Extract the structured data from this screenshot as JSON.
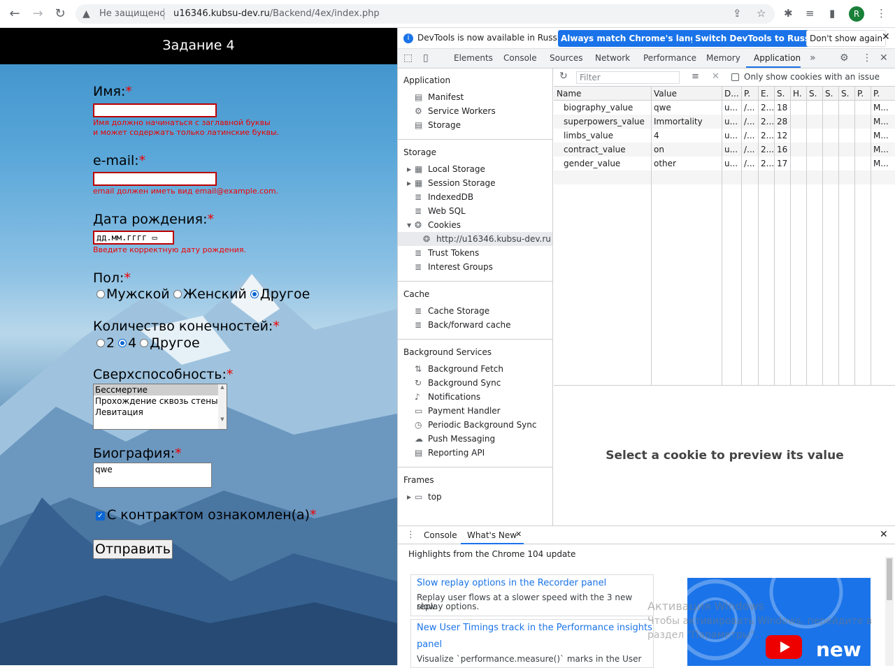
{
  "browser": {
    "security_label": "Не защищено",
    "url_host": "u16346.kubsu-dev.ru",
    "url_path": "/Backend/4ex/index.php",
    "profile_initial": "R"
  },
  "form": {
    "title": "Задание 4",
    "name_label": "Имя:",
    "name_error_line1": "Имя должно начинаться с заглавной буквы",
    "name_error_line2": "и может содержать только латинские буквы.",
    "email_label": "e-mail:",
    "email_error": "email должен иметь вид email@example.com.",
    "dob_label": "Дата рождения:",
    "dob_placeholder": "дд.мм.гггг",
    "dob_error": "Введите корректную дату рождения.",
    "gender_label": "Пол:",
    "gender_options": [
      "Мужской",
      "Женский",
      "Другое"
    ],
    "gender_selected": "Другое",
    "limbs_label": "Количество конечностей:",
    "limbs_options": [
      "2",
      "4",
      "Другое"
    ],
    "limbs_selected": "4",
    "power_label": "Сверхспособность:",
    "power_options": [
      "Бессмертие",
      "Прохождение сквозь стены",
      "Левитация"
    ],
    "power_selected": "Бессмертие",
    "bio_label": "Биография:",
    "bio_value": "qwe",
    "contract_label": "С контрактом ознакомлен(а)",
    "contract_checked": true,
    "required_mark": "*",
    "submit_label": "Отправить"
  },
  "devtools": {
    "infobar_text": "DevTools is now available in Russian!",
    "btn_match": "Always match Chrome's language",
    "btn_switch": "Switch DevTools to Russian",
    "btn_dont_show": "Don't show again",
    "tabs": [
      "Elements",
      "Console",
      "Sources",
      "Network",
      "Performance",
      "Memory",
      "Application"
    ],
    "active_tab": "Application",
    "sidebar": {
      "application_title": "Application",
      "application_items": [
        "Manifest",
        "Service Workers",
        "Storage"
      ],
      "storage_title": "Storage",
      "storage_items": [
        "Local Storage",
        "Session Storage",
        "IndexedDB",
        "Web SQL",
        "Cookies",
        "http://u16346.kubsu-dev.ru",
        "Trust Tokens",
        "Interest Groups"
      ],
      "cache_title": "Cache",
      "cache_items": [
        "Cache Storage",
        "Back/forward cache"
      ],
      "bg_title": "Background Services",
      "bg_items": [
        "Background Fetch",
        "Background Sync",
        "Notifications",
        "Payment Handler",
        "Periodic Background Sync",
        "Push Messaging",
        "Reporting API"
      ],
      "frames_title": "Frames",
      "frames_items": [
        "top"
      ]
    },
    "filter_placeholder": "Filter",
    "only_issues_label": "Only show cookies with an issue",
    "columns": [
      "Name",
      "Value",
      "D...",
      "P.",
      "E.",
      "S.",
      "H.",
      "S.",
      "S.",
      "S.",
      "P.",
      "P."
    ],
    "cookies": [
      {
        "name": "biography_value",
        "value": "qwe",
        "d": "u...",
        "p": "/...",
        "e": "2...",
        "s": "18",
        "last": "M..."
      },
      {
        "name": "superpowers_value",
        "value": "Immortality",
        "d": "u...",
        "p": "/...",
        "e": "2...",
        "s": "28",
        "last": "M..."
      },
      {
        "name": "limbs_value",
        "value": "4",
        "d": "u...",
        "p": "/...",
        "e": "2...",
        "s": "12",
        "last": "M..."
      },
      {
        "name": "contract_value",
        "value": "on",
        "d": "u...",
        "p": "/...",
        "e": "2...",
        "s": "16",
        "last": "M..."
      },
      {
        "name": "gender_value",
        "value": "other",
        "d": "u...",
        "p": "/...",
        "e": "2...",
        "s": "17",
        "last": "M..."
      }
    ],
    "preview_text": "Select a cookie to preview its value",
    "drawer_tabs": [
      "Console",
      "What's New"
    ],
    "highlights": "Highlights from the Chrome 104 update",
    "cards": [
      {
        "title": "Slow replay options in the Recorder panel",
        "text1": "Replay user flows at a slower speed with the 3 new slow",
        "text2": "replay options."
      },
      {
        "title1": "New User Timings track in the Performance insights",
        "title2": "panel",
        "text1": "Visualize `performance.measure()` marks in the User"
      }
    ],
    "video_text": "new",
    "watermark_line1": "Активация Windows",
    "watermark_line2": "Чтобы активировать Windows, перейдите в",
    "watermark_line3": "раздел \"Параметры\"."
  }
}
